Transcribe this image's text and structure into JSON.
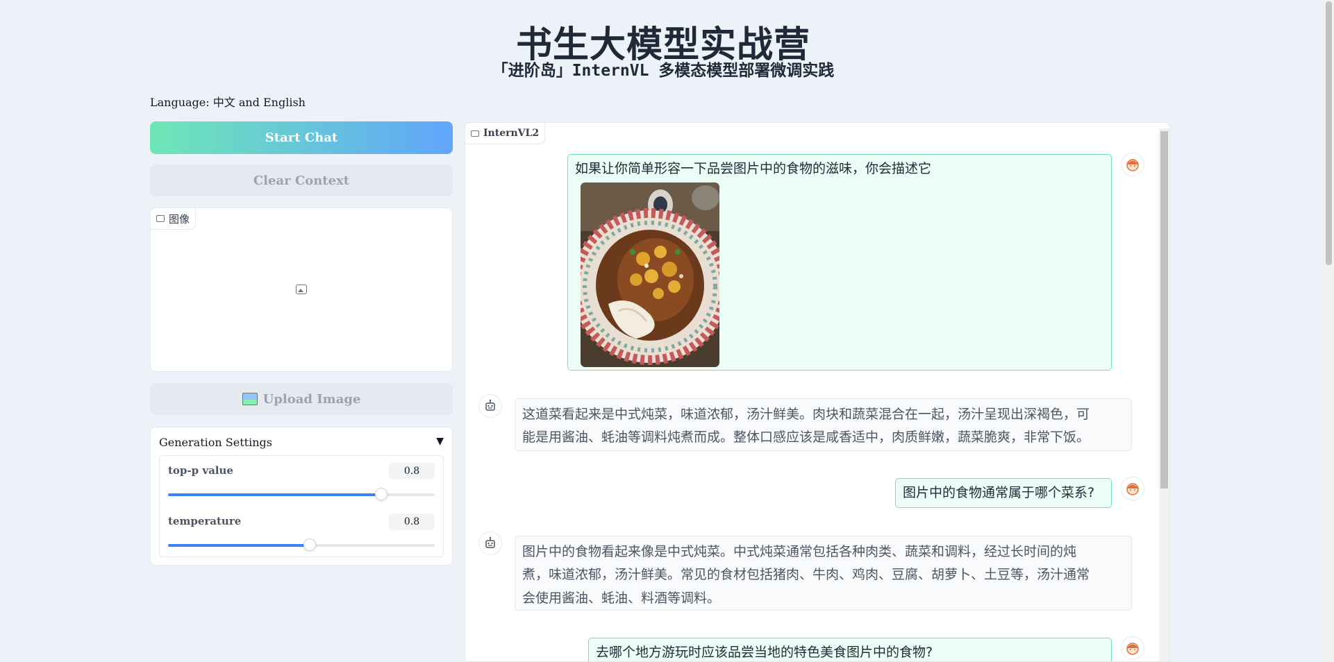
{
  "header": {
    "title": "书生大模型实战营",
    "subtitle": "「进阶岛」InternVL 多模态模型部署微调实践"
  },
  "language_label": "Language: 中文 and English",
  "buttons": {
    "start_chat": "Start Chat",
    "clear_context": "Clear Context",
    "upload_image": "Upload Image"
  },
  "image_panel": {
    "label": "图像"
  },
  "settings": {
    "title": "Generation Settings",
    "toggle": "▼",
    "top_p": {
      "label": "top-p value",
      "value": "0.8",
      "level": 0.8
    },
    "temperature": {
      "label": "temperature",
      "value": "0.8",
      "level": 0.53
    }
  },
  "chat": {
    "label": "InternVL2",
    "messages": [
      {
        "role": "user",
        "text": "如果让你简单形容一下品尝图片中的食物的滋味，你会描述它"
      },
      {
        "role": "bot",
        "lines": [
          "这道菜看起来是中式炖菜，味道浓郁，汤汁鲜美。肉块和蔬菜混合在一起，汤汁呈现出深褐色，可",
          "能是用酱油、蚝油等调料炖煮而成。整体口感应该是咸香适中，肉质鲜嫩，蔬菜脆爽，非常下饭。"
        ]
      },
      {
        "role": "user",
        "text": "图片中的食物通常属于哪个菜系?"
      },
      {
        "role": "bot",
        "lines": [
          "图片中的食物看起来像是中式炖菜。中式炖菜通常包括各种肉类、蔬菜和调料，经过长时间的炖",
          "煮，味道浓郁，汤汁鲜美。常见的食材包括猪肉、牛肉、鸡肉、豆腐、胡萝卜、土豆等，汤汁通常",
          "会使用酱油、蚝油、料酒等调料。"
        ]
      },
      {
        "role": "user",
        "text": "去哪个地方游玩时应该品尝当地的特色美食图片中的食物?"
      }
    ]
  },
  "colors": {
    "accent_start": "#6ee7b7",
    "accent_end": "#60a5fa",
    "user_bubble": "#ecfdf5",
    "user_border": "#6ee7b7",
    "slider": "#3b82f6"
  }
}
